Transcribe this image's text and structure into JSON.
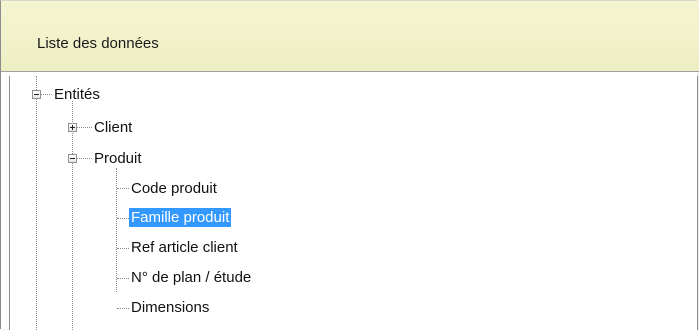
{
  "panel": {
    "title": "Liste des données"
  },
  "tree": {
    "root": {
      "label": "Entités",
      "expanded": true,
      "children": [
        {
          "label": "Client",
          "expanded": false
        },
        {
          "label": "Produit",
          "expanded": true,
          "children": [
            {
              "label": "Code produit",
              "selected": false
            },
            {
              "label": "Famille produit",
              "selected": true
            },
            {
              "label": "Ref article client",
              "selected": false
            },
            {
              "label": "N° de plan / étude",
              "selected": false
            },
            {
              "label": "Dimensions",
              "selected": false
            }
          ]
        }
      ]
    }
  },
  "colors": {
    "header_background": "#f5f5d3",
    "selection_background": "#3399ff",
    "selection_text": "#ffffff"
  },
  "icons": {
    "collapse": "minus-box-icon",
    "expand": "plus-box-icon"
  }
}
